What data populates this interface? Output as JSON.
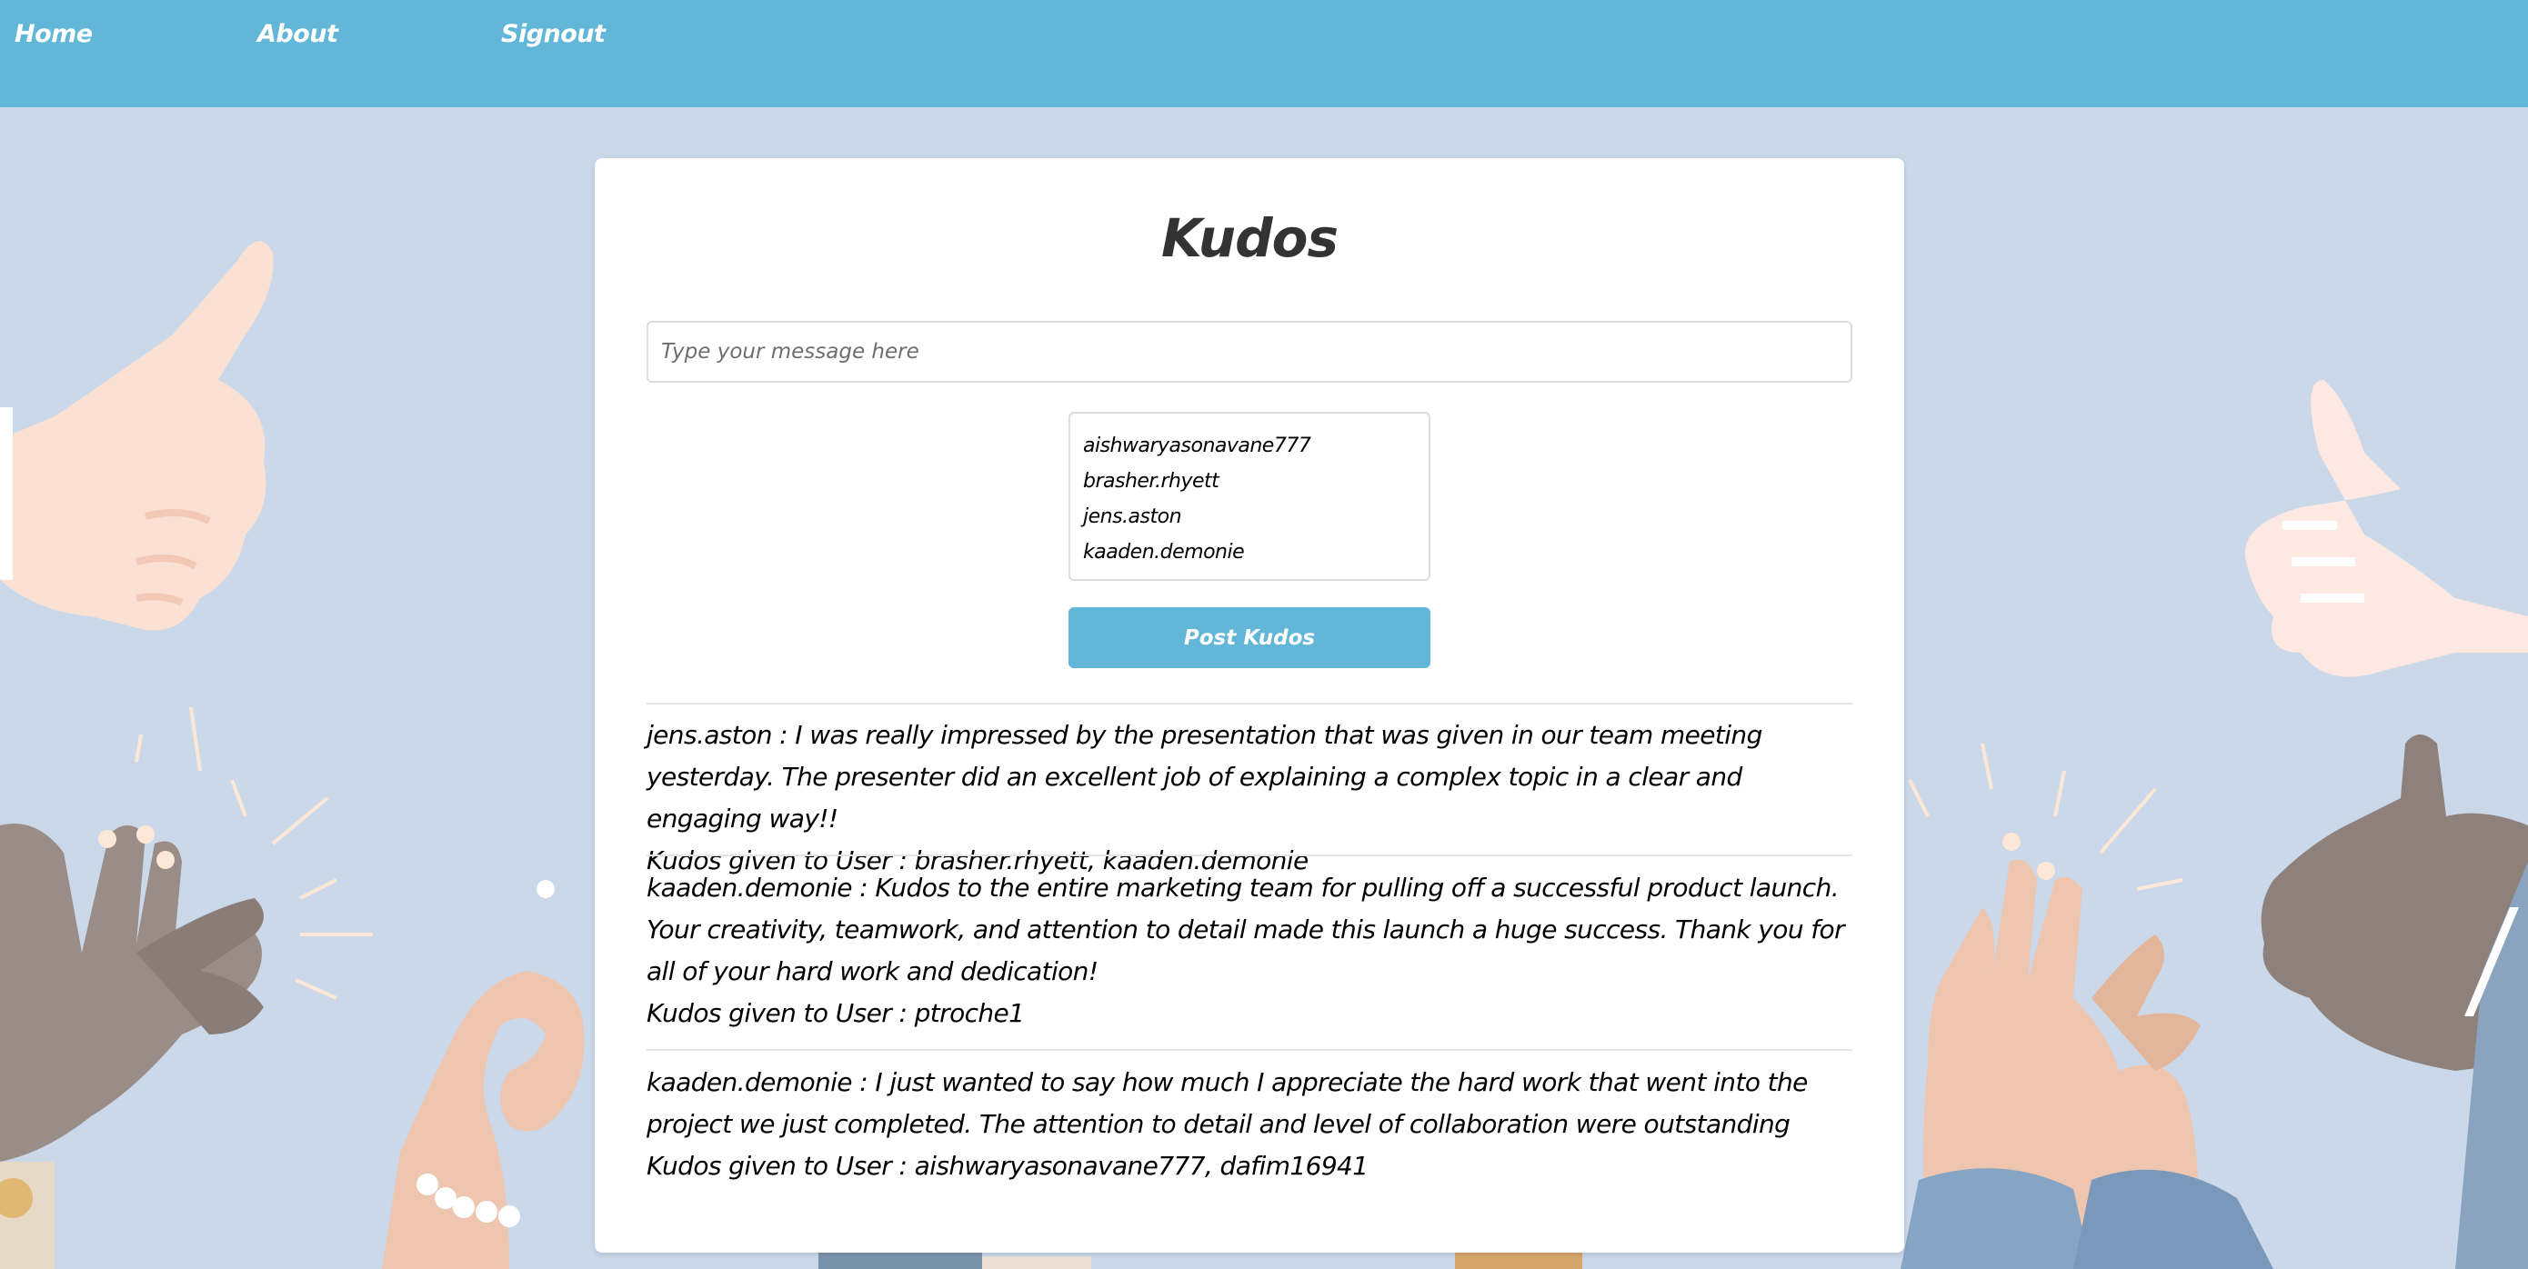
{
  "nav": {
    "home": "Home",
    "about": "About",
    "signout": "Signout"
  },
  "card": {
    "title": "Kudos",
    "message_placeholder": "Type your message here",
    "users": [
      "aishwaryasonavane777",
      "brasher.rhyett",
      "jens.aston",
      "kaaden.demonie"
    ],
    "post_button": "Post Kudos"
  },
  "posts": [
    {
      "text": "jens.aston : I was really impressed by the presentation that was given in our team meeting yesterday. The presenter did an excellent job of explaining a complex topic in a clear and engaging way!!",
      "recipients": "Kudos given to User : brasher.rhyett, kaaden.demonie"
    },
    {
      "text": "kaaden.demonie : Kudos to the entire marketing team for pulling off a successful product launch. Your creativity, teamwork, and attention to detail made this launch a huge success. Thank you for all of your hard work and dedication!",
      "recipients": "Kudos given to User : ptroche1"
    },
    {
      "text": "kaaden.demonie : I just wanted to say how much I appreciate the hard work that went into the project we just completed. The attention to detail and level of collaboration were outstanding",
      "recipients": "Kudos given to User : aishwaryasonavane777, dafim16941"
    }
  ],
  "colors": {
    "navbar": "#62b7d8",
    "background": "#cad8ea",
    "button": "#62b7d8"
  }
}
